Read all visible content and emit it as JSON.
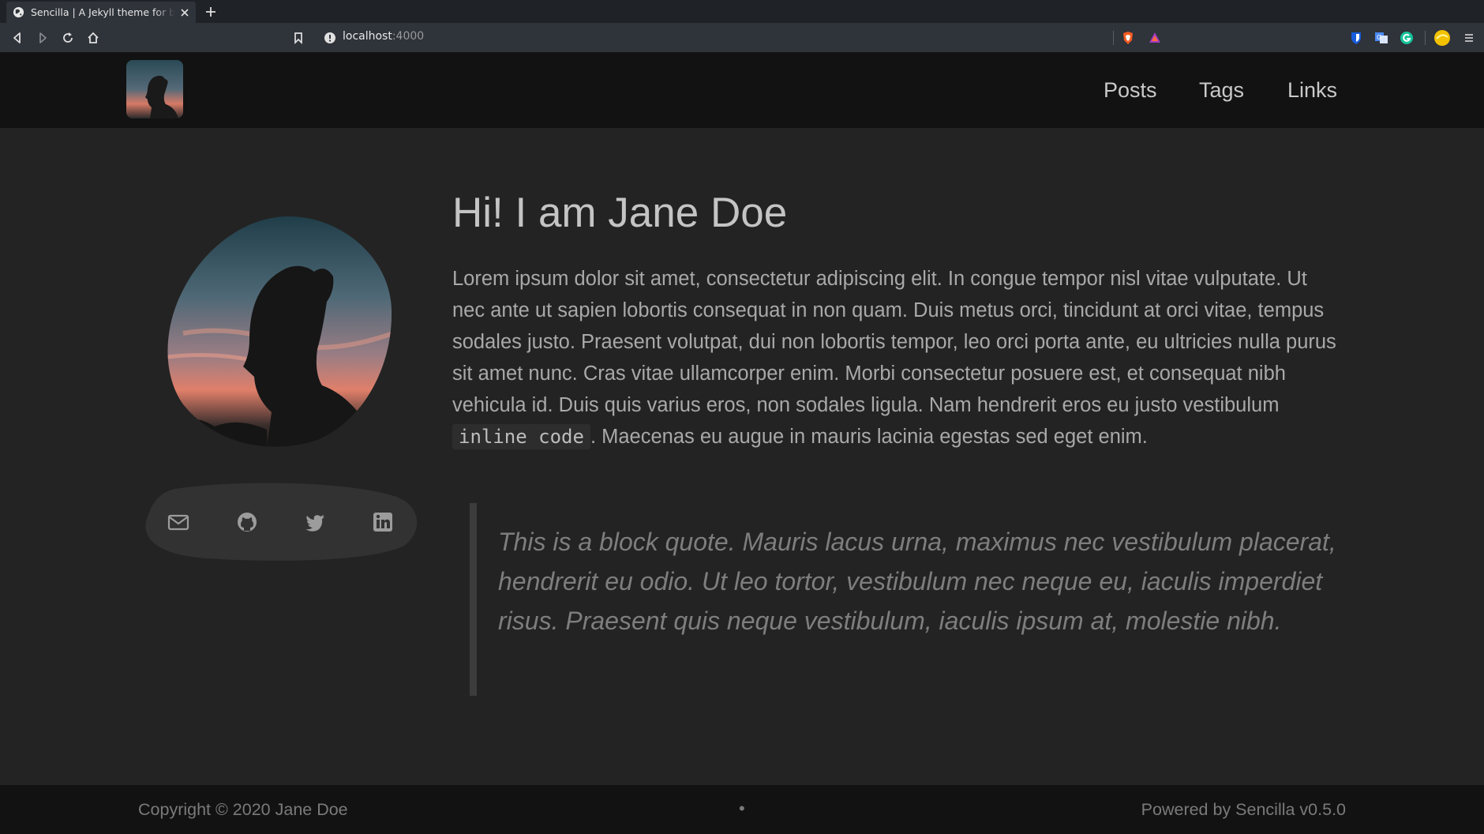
{
  "browser": {
    "tab_title": "Sencilla | A Jekyll theme for blogs",
    "url_host": "localhost",
    "url_port": ":4000"
  },
  "header": {
    "nav": [
      "Posts",
      "Tags",
      "Links"
    ]
  },
  "main": {
    "heading": "Hi! I am Jane Doe",
    "intro_before_code": "Lorem ipsum dolor sit amet, consectetur adipiscing elit. In congue tempor nisl vitae vulputate. Ut nec ante ut sapien lobortis consequat in non quam. Duis metus orci, tincidunt at orci vitae, tempus sodales justo. Praesent volutpat, dui non lobortis tempor, leo orci porta ante, eu ultricies nulla purus sit amet nunc. Cras vitae ullamcorper enim. Morbi consectetur posuere est, et consequat nibh vehicula id. Duis quis varius eros, non sodales ligula. Nam hendrerit eros eu justo vestibulum",
    "inline_code": "inline code",
    "intro_after_code": ". Maecenas eu augue in mauris lacinia egestas sed eget enim.",
    "blockquote": "This is a block quote. Mauris lacus urna, maximus nec vestibulum placerat, hendrerit eu odio. Ut leo tortor, vestibulum nec neque eu, iaculis imperdiet risus. Praesent quis neque vestibulum, iaculis ipsum at, molestie nibh."
  },
  "social": [
    "mail-icon",
    "github-icon",
    "twitter-icon",
    "linkedin-icon"
  ],
  "footer": {
    "copyright": "Copyright © 2020 Jane Doe",
    "separator": "•",
    "powered_by": "Powered by Sencilla v0.5.0"
  },
  "colors": {
    "page_bg": "#232323",
    "header_bg": "#121212",
    "text": "#a9a9a9",
    "quote_text": "#7e7e7e"
  }
}
